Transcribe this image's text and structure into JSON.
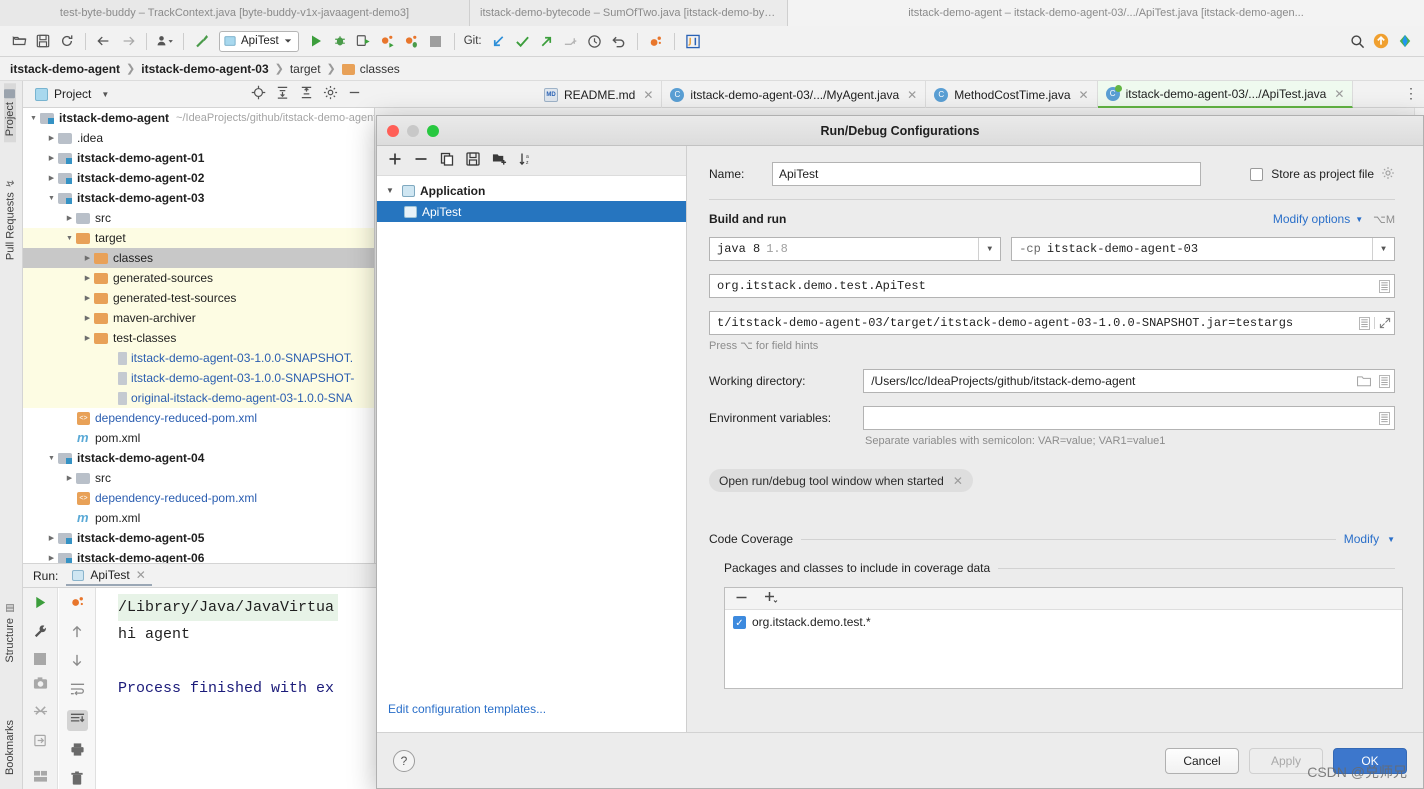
{
  "window_tabs": [
    {
      "title": "test-byte-buddy – TrackContext.java [byte-buddy-v1x-javaagent-demo3]"
    },
    {
      "title": "itstack-demo-bytecode – SumOfTwo.java [itstack-demo-bytecode-3-01]"
    },
    {
      "title": "itstack-demo-agent – itstack-demo-agent-03/.../ApiTest.java [itstack-demo-agen..."
    }
  ],
  "toolbar": {
    "run_config_name": "ApiTest",
    "git_label": "Git:",
    "icons": [
      "open-folder-icon",
      "save-all-icon",
      "sync-icon",
      "back-arrow-icon",
      "forward-arrow-icon",
      "profile-dropdown-icon",
      "build-hammer-icon",
      "run-icon",
      "debug-icon",
      "run-with-coverage-icon",
      "profiler-run-icon",
      "profiler-debug-icon",
      "stop-icon",
      "git-update-icon",
      "git-commit-icon",
      "git-push-icon",
      "git-branch-icon",
      "git-history-icon",
      "git-rollback-icon",
      "bug-icon",
      "plugin-icon",
      "search-icon",
      "update-available-icon"
    ]
  },
  "breadcrumb": {
    "items": [
      "itstack-demo-agent",
      "itstack-demo-agent-03",
      "target",
      "classes"
    ]
  },
  "left_rail": {
    "top": "Project",
    "second": "Pull Requests",
    "bottom_a": "Structure",
    "bottom_b": "Bookmarks"
  },
  "project_panel": {
    "title": "Project",
    "action_icons": [
      "locate-icon",
      "expand-all-icon",
      "collapse-all-icon",
      "settings-gear-icon",
      "hide-icon"
    ]
  },
  "editor_tabs": [
    {
      "label": "README.md",
      "icon": "markdown-icon",
      "active": false
    },
    {
      "label": "itstack-demo-agent-03/.../MyAgent.java",
      "icon": "java-class-icon",
      "active": false
    },
    {
      "label": "MethodCostTime.java",
      "icon": "java-class-icon",
      "active": false
    },
    {
      "label": "itstack-demo-agent-03/.../ApiTest.java",
      "icon": "java-test-icon",
      "active": true
    }
  ],
  "tree": [
    {
      "label": "itstack-demo-agent",
      "path": "~/IdeaProjects/github/itstack-demo-agent",
      "indent": 0,
      "arrow": "down",
      "icon": "module-icon",
      "bold": true,
      "hl": false
    },
    {
      "label": ".idea",
      "indent": 1,
      "arrow": "right",
      "icon": "folder-gray-icon",
      "bold": false,
      "hl": false
    },
    {
      "label": "itstack-demo-agent-01",
      "indent": 1,
      "arrow": "right",
      "icon": "module-icon",
      "bold": true,
      "hl": false
    },
    {
      "label": "itstack-demo-agent-02",
      "indent": 1,
      "arrow": "right",
      "icon": "module-icon",
      "bold": true,
      "hl": false
    },
    {
      "label": "itstack-demo-agent-03",
      "indent": 1,
      "arrow": "down",
      "icon": "module-icon",
      "bold": true,
      "hl": false
    },
    {
      "label": "src",
      "indent": 2,
      "arrow": "right",
      "icon": "folder-gray-icon",
      "bold": false,
      "hl": false
    },
    {
      "label": "target",
      "indent": 2,
      "arrow": "down",
      "icon": "folder-orange-icon",
      "bold": false,
      "hl": true
    },
    {
      "label": "classes",
      "indent": 3,
      "arrow": "right",
      "icon": "folder-orange-icon",
      "bold": false,
      "hl": true,
      "selected": true
    },
    {
      "label": "generated-sources",
      "indent": 3,
      "arrow": "right",
      "icon": "folder-orange-icon",
      "bold": false,
      "hl": true
    },
    {
      "label": "generated-test-sources",
      "indent": 3,
      "arrow": "right",
      "icon": "folder-orange-icon",
      "bold": false,
      "hl": true
    },
    {
      "label": "maven-archiver",
      "indent": 3,
      "arrow": "right",
      "icon": "folder-orange-icon",
      "bold": false,
      "hl": true
    },
    {
      "label": "test-classes",
      "indent": 3,
      "arrow": "right",
      "icon": "folder-orange-icon",
      "bold": false,
      "hl": true
    },
    {
      "label": "itstack-demo-agent-03-1.0.0-SNAPSHOT.",
      "indent": 4,
      "arrow": "none",
      "icon": "jar-icon",
      "bold": false,
      "hl": true,
      "blue": true
    },
    {
      "label": "itstack-demo-agent-03-1.0.0-SNAPSHOT-",
      "indent": 4,
      "arrow": "none",
      "icon": "jar-icon",
      "bold": false,
      "hl": true,
      "blue": true
    },
    {
      "label": "original-itstack-demo-agent-03-1.0.0-SNA",
      "indent": 4,
      "arrow": "none",
      "icon": "jar-icon",
      "bold": false,
      "hl": true,
      "blue": true
    },
    {
      "label": "dependency-reduced-pom.xml",
      "indent": 2,
      "arrow": "none",
      "icon": "xml-icon",
      "bold": false,
      "hl": false,
      "blue": true
    },
    {
      "label": "pom.xml",
      "indent": 2,
      "arrow": "none",
      "icon": "maven-icon",
      "bold": false,
      "hl": false
    },
    {
      "label": "itstack-demo-agent-04",
      "indent": 1,
      "arrow": "down",
      "icon": "module-icon",
      "bold": true,
      "hl": false
    },
    {
      "label": "src",
      "indent": 2,
      "arrow": "right",
      "icon": "folder-gray-icon",
      "bold": false,
      "hl": false
    },
    {
      "label": "dependency-reduced-pom.xml",
      "indent": 2,
      "arrow": "none",
      "icon": "xml-icon",
      "bold": false,
      "hl": false,
      "blue": true
    },
    {
      "label": "pom.xml",
      "indent": 2,
      "arrow": "none",
      "icon": "maven-icon",
      "bold": false,
      "hl": false
    },
    {
      "label": "itstack-demo-agent-05",
      "indent": 1,
      "arrow": "right",
      "icon": "module-icon",
      "bold": true,
      "hl": false
    },
    {
      "label": "itstack-demo-agent-06",
      "indent": 1,
      "arrow": "right",
      "icon": "module-icon",
      "bold": true,
      "hl": false
    }
  ],
  "run_window": {
    "label": "Run:",
    "tab_name": "ApiTest",
    "left_icons": [
      "rerun-icon",
      "wrench-icon",
      "stop-icon",
      "camera-icon",
      "thread-dump-icon",
      "export-icon",
      "layout-icon"
    ],
    "left2_icons": [
      "coverage-icon",
      "up-arrow-icon",
      "down-arrow-icon",
      "soft-wrap-icon",
      "scroll-to-end-icon",
      "print-icon",
      "trash-icon"
    ],
    "console_lines": [
      {
        "text": "/Library/Java/JavaVirtua",
        "style": "highlight"
      },
      {
        "text": "hi agent",
        "style": "normal"
      },
      {
        "text": "",
        "style": "normal"
      },
      {
        "text": "Process finished with ex",
        "style": "navy"
      }
    ]
  },
  "dialog": {
    "title": "Run/Debug Configurations",
    "toolbar_icons": [
      "add-icon",
      "remove-icon",
      "copy-icon",
      "save-icon",
      "folder-add-icon",
      "sort-icon"
    ],
    "tree": [
      {
        "label": "Application",
        "type": "group"
      },
      {
        "label": "ApiTest",
        "type": "config",
        "selected": true
      }
    ],
    "edit_templates_link": "Edit configuration templates...",
    "name_label": "Name:",
    "name_value": "ApiTest",
    "store_as_project_file_label": "Store as project file",
    "store_as_project_file_checked": false,
    "build_and_run_label": "Build and run",
    "modify_options_label": "Modify options",
    "modify_options_shortcut": "⌥M",
    "jre_value": "java 8",
    "jre_version": "1.8",
    "classpath_prefix": "-cp",
    "classpath_value": "itstack-demo-agent-03",
    "main_class_value": "org.itstack.demo.test.ApiTest",
    "vm_args_value": "t/itstack-demo-agent-03/target/itstack-demo-agent-03-1.0.0-SNAPSHOT.jar=testargs",
    "field_hint": "Press ⌥ for field hints",
    "working_dir_label": "Working directory:",
    "working_dir_value": "/Users/lcc/IdeaProjects/github/itstack-demo-agent",
    "env_vars_label": "Environment variables:",
    "env_vars_value": "",
    "env_vars_hint": "Separate variables with semicolon: VAR=value; VAR1=value1",
    "open_tool_window_chip": "Open run/debug tool window when started",
    "code_coverage_label": "Code Coverage",
    "code_coverage_modify": "Modify",
    "packages_label": "Packages and classes to include in coverage data",
    "coverage_items": [
      {
        "label": "org.itstack.demo.test.*",
        "checked": true
      }
    ],
    "buttons": {
      "help": "?",
      "cancel": "Cancel",
      "apply": "Apply",
      "ok": "OK"
    }
  },
  "watermark": "CSDN @兑师兄",
  "colors": {
    "accent_blue": "#2675bf",
    "link_blue": "#2a6fc9",
    "primary_button": "#3d77cc",
    "highlight_yellow": "#fdfce3",
    "folder_orange": "#e8a158",
    "active_tab_green": "#62b543"
  }
}
